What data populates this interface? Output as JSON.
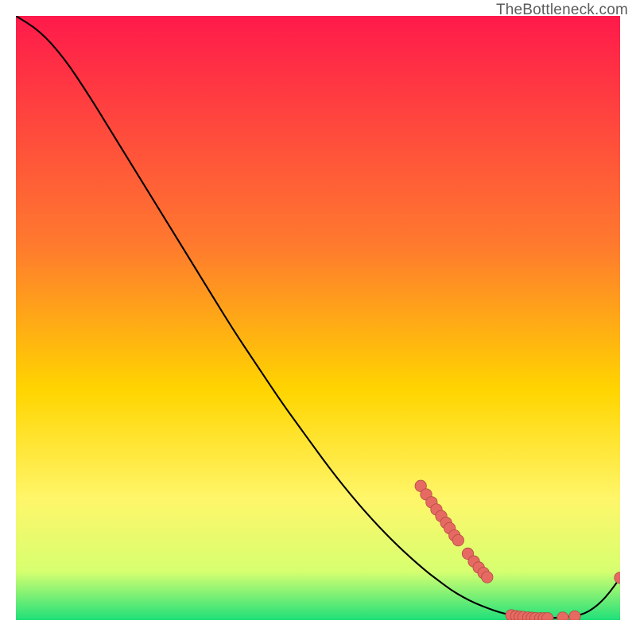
{
  "watermark": "TheBottleneck.com",
  "colors": {
    "curve": "#000000",
    "dot_fill": "#e66a62",
    "dot_stroke": "#b34b45",
    "grad_top": "#ff1a4b",
    "grad_mid1": "#ff7a2e",
    "grad_mid2": "#ffd500",
    "grad_mid3": "#fff66a",
    "grad_mid4": "#d6ff70",
    "grad_bottom": "#1fe07a"
  },
  "chart_data": {
    "type": "line",
    "title": "",
    "xlabel": "",
    "ylabel": "",
    "xlim": [
      0,
      100
    ],
    "ylim": [
      0,
      100
    ],
    "series": [
      {
        "name": "bottleneck-curve",
        "x": [
          0,
          4,
          8,
          12,
          16,
          20,
          24,
          28,
          32,
          36,
          40,
          44,
          48,
          52,
          56,
          60,
          64,
          68,
          70,
          72,
          74,
          76,
          78,
          80,
          82,
          84,
          86,
          88,
          90,
          92,
          94,
          96,
          98,
          100
        ],
        "values": [
          100.0,
          97.5,
          93.0,
          87.0,
          80.5,
          74.0,
          67.5,
          61.0,
          54.5,
          48.0,
          42.0,
          36.0,
          30.5,
          25.0,
          20.0,
          15.5,
          11.5,
          8.0,
          6.5,
          5.0,
          3.8,
          2.8,
          2.0,
          1.3,
          0.8,
          0.5,
          0.3,
          0.3,
          0.4,
          0.6,
          1.0,
          2.2,
          4.2,
          7.0
        ]
      }
    ],
    "highlight_clusters": [
      {
        "name": "descending-dots",
        "x": [
          67.0,
          67.9,
          68.8,
          69.6,
          70.4,
          71.2,
          71.8,
          72.6,
          73.2,
          74.8,
          75.8,
          76.6,
          77.4,
          78.0
        ],
        "values": [
          22.2,
          20.8,
          19.5,
          18.3,
          17.2,
          16.1,
          15.2,
          14.0,
          13.2,
          11.0,
          9.7,
          8.7,
          7.8,
          7.1
        ]
      },
      {
        "name": "bottom-dots",
        "x": [
          82.0,
          82.8,
          83.4,
          84.0,
          84.8,
          85.4,
          86.0,
          86.8,
          87.4,
          88.0,
          90.5,
          92.5
        ],
        "values": [
          0.8,
          0.65,
          0.55,
          0.5,
          0.42,
          0.36,
          0.32,
          0.3,
          0.3,
          0.3,
          0.4,
          0.6
        ]
      },
      {
        "name": "tail-end-dot",
        "x": [
          100.0
        ],
        "values": [
          7.0
        ]
      }
    ]
  }
}
